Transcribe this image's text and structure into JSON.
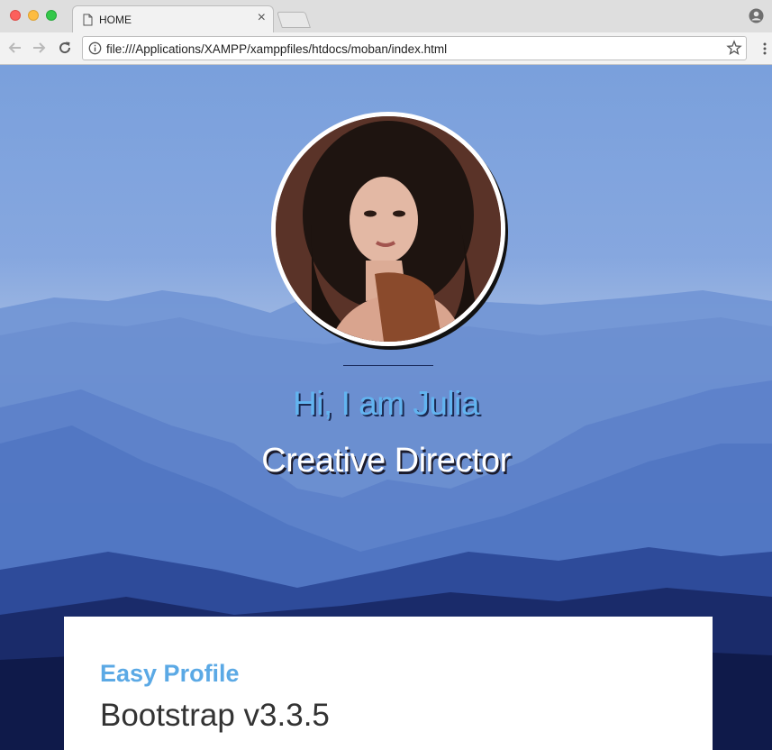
{
  "browser": {
    "tab_title": "HOME",
    "tab_close": "×",
    "url": "file:///Applications/XAMPP/xamppfiles/htdocs/moban/index.html",
    "icons": [
      "document-icon",
      "close-icon",
      "new-tab",
      "profile-icon",
      "back-icon",
      "forward-icon",
      "reload-icon",
      "info-icon",
      "star-icon",
      "menu-icon"
    ]
  },
  "hero": {
    "greeting": "Hi, I am Julia",
    "role": "Creative Director"
  },
  "card": {
    "title": "Easy Profile",
    "subtitle": "Bootstrap v3.3.5"
  },
  "colors": {
    "accent": "#5ba9e5",
    "greeting": "#62b4f0",
    "sky": "#7aa0dc",
    "card_bg": "#ffffff"
  }
}
